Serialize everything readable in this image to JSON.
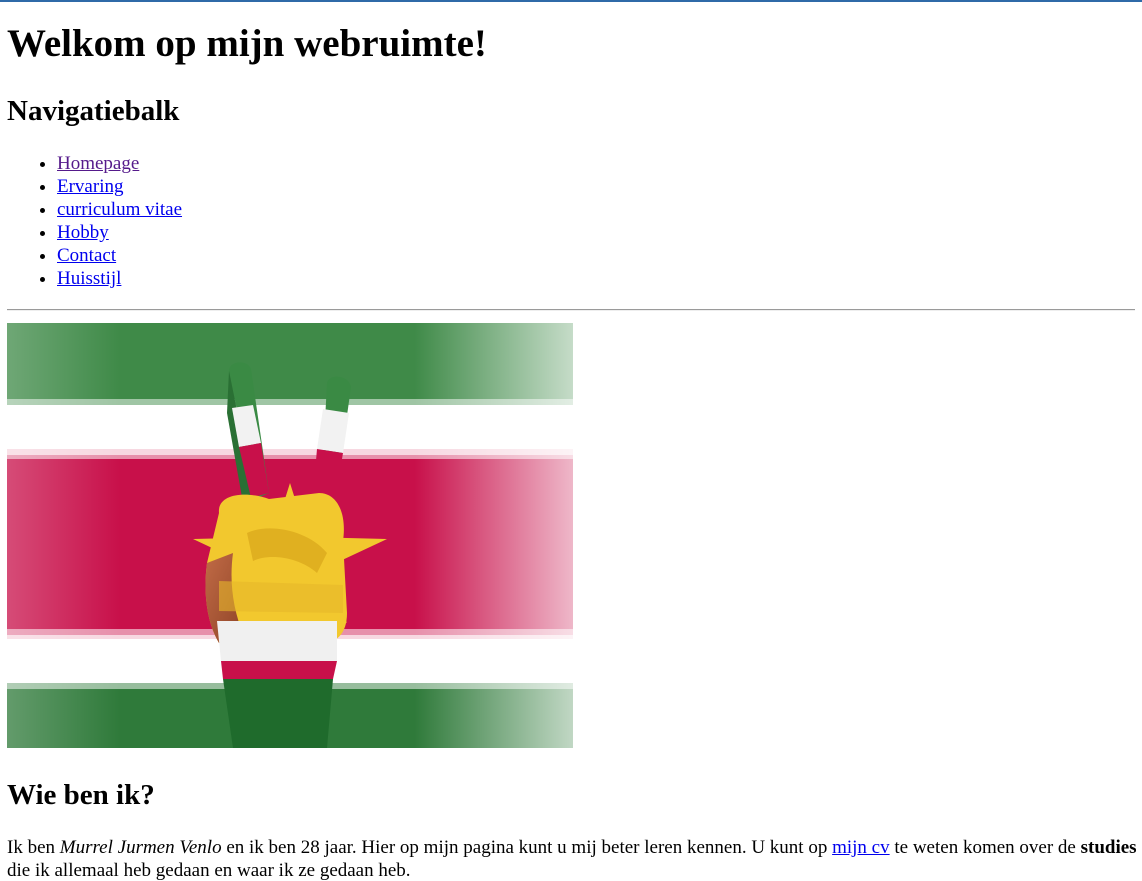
{
  "page": {
    "heading": "Welkom op mijn webruimte!",
    "nav_title": "Navigatiebalk"
  },
  "nav": {
    "items": [
      {
        "label": "Homepage",
        "visited": true
      },
      {
        "label": "Ervaring",
        "visited": false
      },
      {
        "label": "curriculum vitae",
        "visited": false
      },
      {
        "label": "Hobby",
        "visited": false
      },
      {
        "label": "Contact",
        "visited": false
      },
      {
        "label": "Huisstijl",
        "visited": false
      }
    ]
  },
  "hero": {
    "colors": {
      "green": "#2e7d3a",
      "white": "#ffffff",
      "red": "#c8104a",
      "yellow": "#f2c82e"
    }
  },
  "about": {
    "title": "Wie ben ik?",
    "intro_1": "Ik ben ",
    "name": "Murrel Jurmen Venlo",
    "intro_2": " en ik ben 28 jaar. Hier op mijn pagina kunt u mij beter leren kennen. U kunt op ",
    "cv_link": "mijn cv",
    "intro_3": " te weten komen over de ",
    "studies": "studies",
    "intro_4": " die ik allemaal heb gedaan en waar ik ze gedaan heb."
  },
  "colors": {
    "link": "#0000ee",
    "visited_link": "#551a8b",
    "top_border": "#2f6aa8"
  }
}
